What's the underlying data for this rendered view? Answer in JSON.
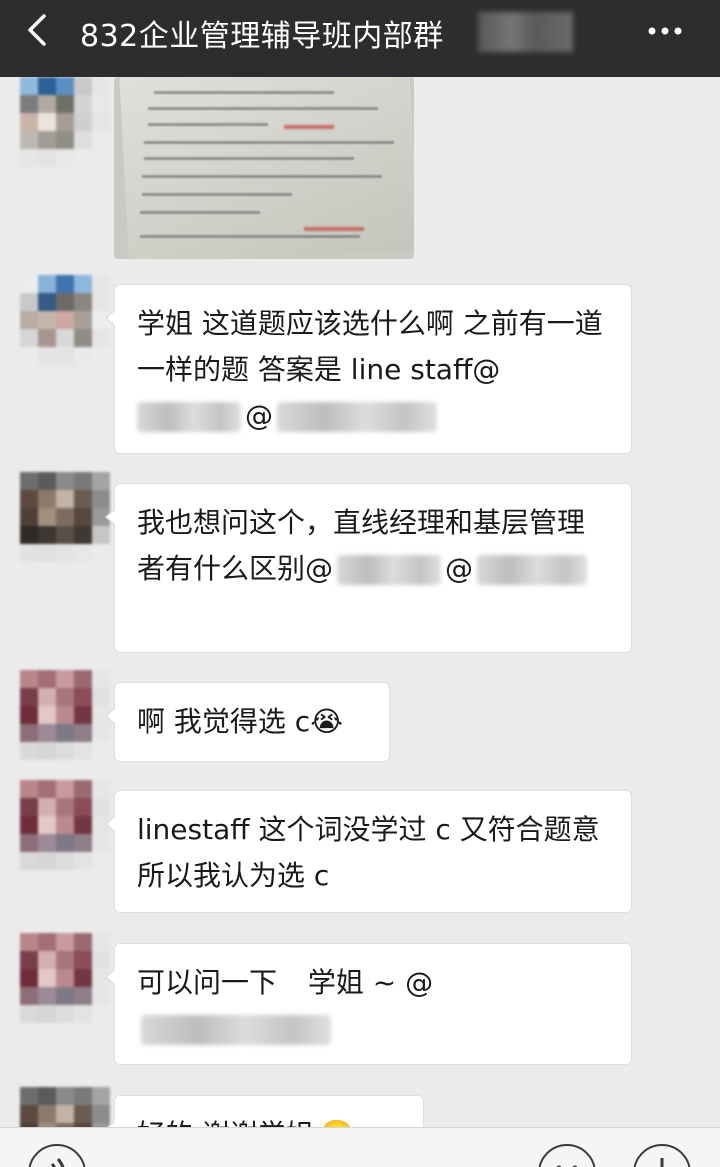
{
  "header": {
    "title": "832企业管理辅导班内部群",
    "back_icon": "chevron-left-icon",
    "more_icon": "more-dots-icon"
  },
  "messages": [
    {
      "type": "image"
    },
    {
      "type": "text",
      "parts": [
        "学姐 这道题应该选什么啊 之前有一道一样的题 答案是 line staff@",
        "@"
      ]
    },
    {
      "type": "text",
      "parts": [
        "我也想问这个，直线经理和基层管理者有什么区别@",
        "@"
      ]
    },
    {
      "type": "text",
      "parts": [
        "啊 我觉得选 c"
      ],
      "emoji": "😭"
    },
    {
      "type": "text",
      "parts": [
        "linestaff 这个词没学过 c 又符合题意 所以我认为选 c"
      ]
    },
    {
      "type": "text",
      "parts": [
        "可以问一下 ",
        "学姐 ~ @"
      ]
    },
    {
      "type": "text",
      "parts": [
        "好的 谢谢学姐"
      ],
      "emoji": "🙂"
    }
  ],
  "footer": {
    "voice_icon": "voice-icon",
    "emoji_icon": "emoji-icon",
    "plus_icon": "plus-icon"
  }
}
